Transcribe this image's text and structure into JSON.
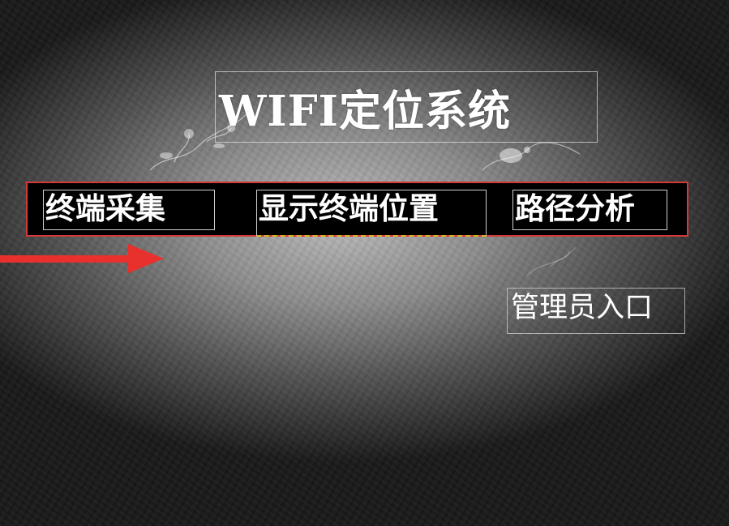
{
  "page": {
    "title": "WIFI定位系统"
  },
  "nav": {
    "items": [
      {
        "label": "终端采集"
      },
      {
        "label": "显示终端位置"
      },
      {
        "label": "路径分析"
      }
    ]
  },
  "admin": {
    "label": "管理员入口"
  },
  "colors": {
    "nav_border": "#d23a3a",
    "nav_background": "#000000",
    "arrow": "#e8302c",
    "focus_underline": "#d8b21e",
    "text": "#ffffff"
  },
  "icons": {
    "arrow": "right-arrow-icon",
    "decoration": "floral-ornament"
  }
}
